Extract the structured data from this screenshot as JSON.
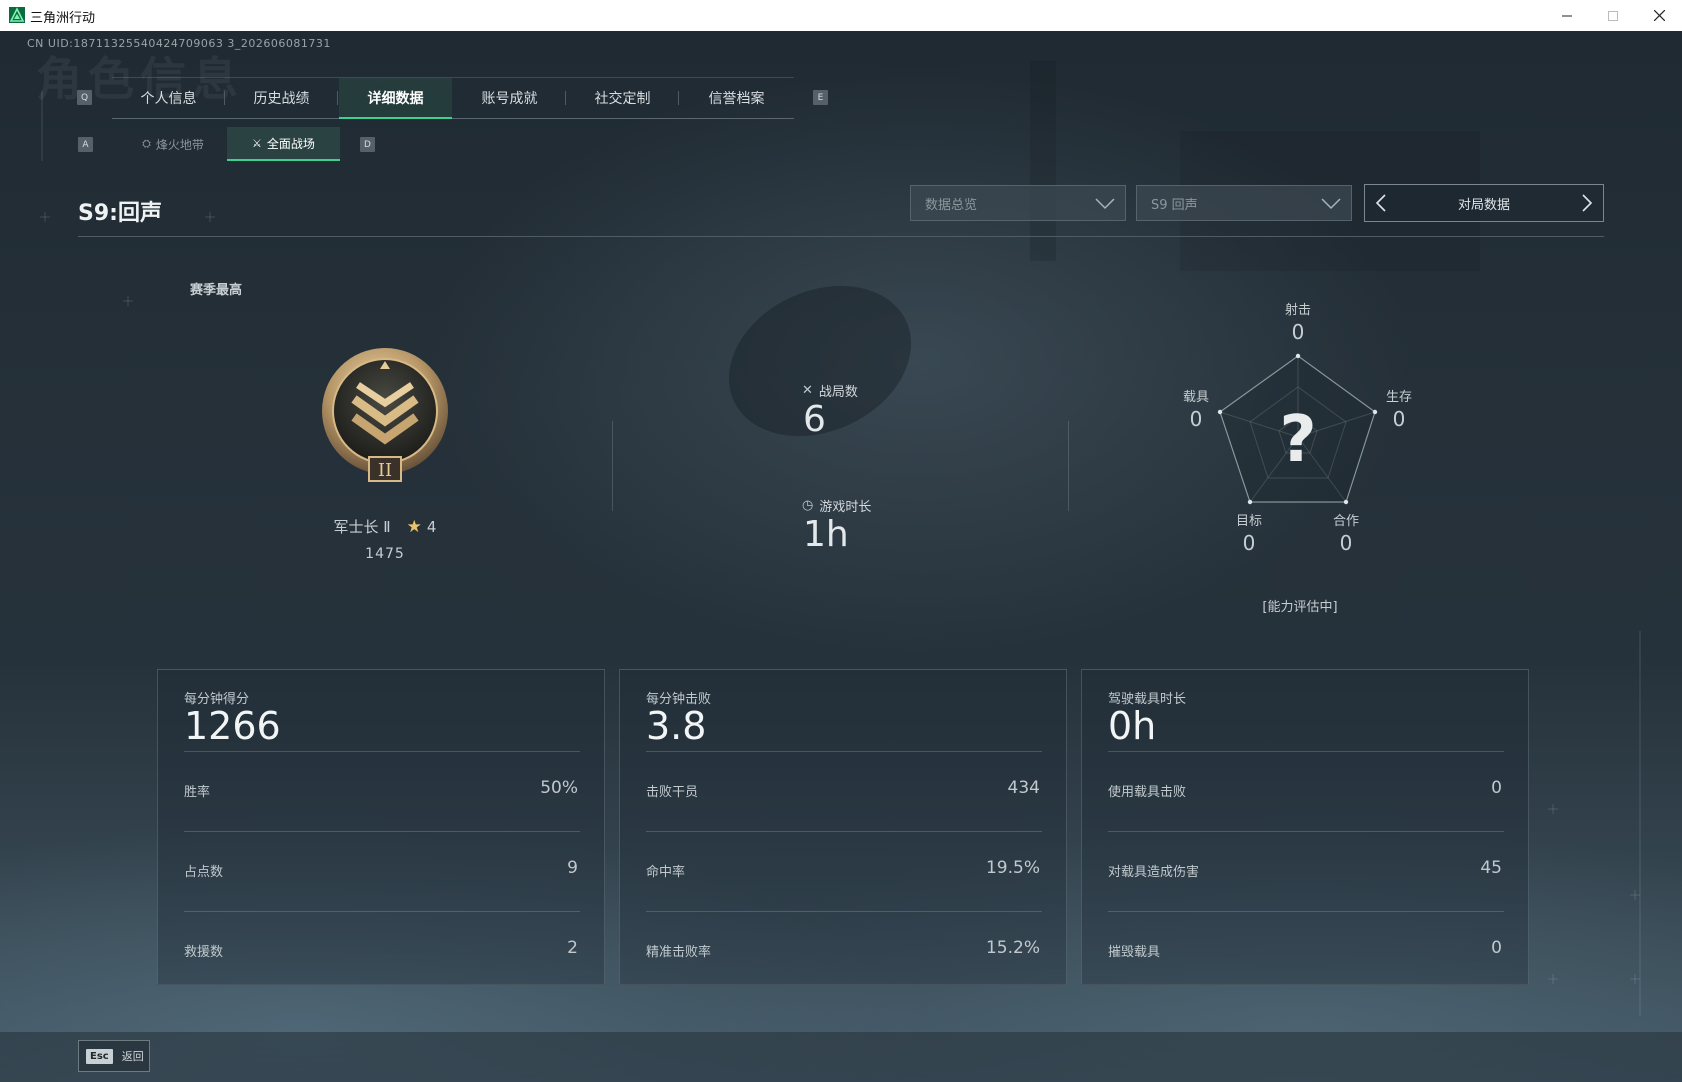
{
  "window": {
    "title": "三角洲行动",
    "controls": [
      "minimize-icon",
      "maximize-icon",
      "close-icon"
    ]
  },
  "uid_text": "CN UID:18711325540424709063 3_202606081731",
  "watermark": "角色信息",
  "tabs": {
    "left_key": "Q",
    "right_key": "E",
    "items": [
      {
        "label": "个人信息",
        "active": false
      },
      {
        "label": "历史战绩",
        "active": false
      },
      {
        "label": "详细数据",
        "active": true
      },
      {
        "label": "账号成就",
        "active": false
      },
      {
        "label": "社交定制",
        "active": false
      },
      {
        "label": "信誉档案",
        "active": false
      }
    ]
  },
  "subtabs": {
    "left_key": "A",
    "right_key": "D",
    "items": [
      {
        "label": "烽火地带",
        "icon": "extraction-icon",
        "active": false
      },
      {
        "label": "全面战场",
        "icon": "battlefield-icon",
        "active": true
      }
    ]
  },
  "season_title": "S9:回声",
  "filters": {
    "dropdown1": "数据总览",
    "dropdown2": "S9 回声",
    "pager_label": "对局数据"
  },
  "rank": {
    "section_label": "赛季最高",
    "name": "军士长 Ⅱ",
    "stars": "4",
    "score": "1475",
    "medal_numeral": "II"
  },
  "match_stats": {
    "games_label": "战局数",
    "games_value": "6",
    "time_label": "游戏时长",
    "time_value": "1h"
  },
  "radar": {
    "center_mark": "?",
    "axes": [
      {
        "label": "射击",
        "value": "0"
      },
      {
        "label": "生存",
        "value": "0"
      },
      {
        "label": "合作",
        "value": "0"
      },
      {
        "label": "目标",
        "value": "0"
      },
      {
        "label": "载具",
        "value": "0"
      }
    ],
    "status": "[能力评估中]"
  },
  "cards": [
    {
      "label": "每分钟得分",
      "value": "1266",
      "rows": [
        {
          "k": "胜率",
          "v": "50%"
        },
        {
          "k": "占点数",
          "v": "9"
        },
        {
          "k": "救援数",
          "v": "2"
        }
      ]
    },
    {
      "label": "每分钟击败",
      "value": "3.8",
      "rows": [
        {
          "k": "击败干员",
          "v": "434"
        },
        {
          "k": "命中率",
          "v": "19.5%"
        },
        {
          "k": "精准击败率",
          "v": "15.2%"
        }
      ]
    },
    {
      "label": "驾驶载具时长",
      "value": "0h",
      "rows": [
        {
          "k": "使用载具击败",
          "v": "0"
        },
        {
          "k": "对载具造成伤害",
          "v": "45"
        },
        {
          "k": "摧毁载具",
          "v": "0"
        }
      ]
    }
  ],
  "footer": {
    "esc_key": "Esc",
    "back_label": "返回"
  },
  "colors": {
    "accent": "#3fcf8e",
    "star": "#e9c56a",
    "medal_gold": "#b89868"
  }
}
